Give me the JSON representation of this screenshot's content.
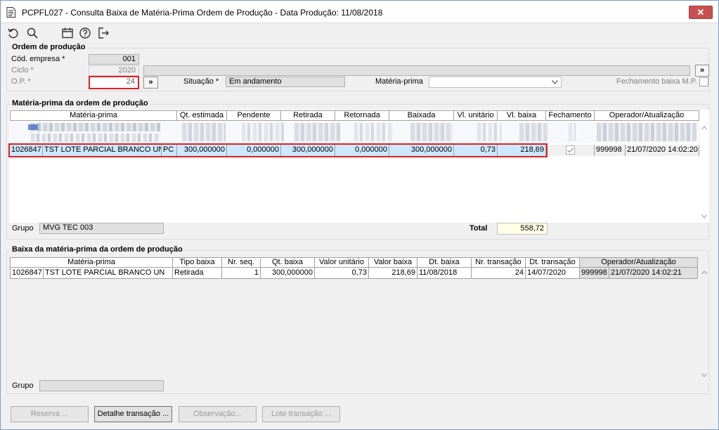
{
  "window": {
    "title": "PCPFL027 - Consulta Baixa de Matéria-Prima Ordem de Produção - Data Produção: 11/08/2018",
    "close": "✕"
  },
  "toolbar": {
    "icons": [
      "undo-icon",
      "search-icon",
      "calendar-icon",
      "help-icon",
      "exit-icon"
    ]
  },
  "ordem": {
    "title": "Ordem de produção",
    "cod_empresa_label": "Cód. empresa *",
    "cod_empresa_value": "001",
    "ciclo_label": "Ciclo *",
    "ciclo_value": "2020",
    "op_label": "O.P. *",
    "op_value": "24",
    "nav_button": "»",
    "nav_button2": "»",
    "situacao_label": "Situação *",
    "situacao_value": "Em andamento",
    "materia_prima_label": "Matéria-prima",
    "fechamento_label": "Fechamento baixa M.P."
  },
  "mp_ordem": {
    "title": "Matéria-prima da ordem de produção",
    "headers": [
      "Matéria-prima",
      "Qt. estimada",
      "Pendente",
      "Retirada",
      "Retornada",
      "Baixada",
      "Vl. unitário",
      "Vl. baixa",
      "Fechamento",
      "Operador/Atualização"
    ],
    "row": {
      "codigo": "1026847",
      "descricao": "TST LOTE PARCIAL BRANCO UN",
      "un": "PC",
      "qt_estimada": "300,000000",
      "pendente": "0,000000",
      "retirada": "300,000000",
      "retornada": "0,000000",
      "baixada": "300,000000",
      "vl_unitario": "0,73",
      "vl_baixa": "218,69",
      "operador": "999998",
      "atualizacao": "21/07/2020 14:02:20"
    },
    "grupo_label": "Grupo",
    "grupo_value": "MVG TEC 003",
    "total_label": "Total",
    "total_value": "558,72"
  },
  "baixa": {
    "title": "Baixa da matéria-prima da ordem de produção",
    "headers": [
      "Matéria-prima",
      "Tipo baixa",
      "Nr. seq.",
      "Qt. baixa",
      "Valor unitário",
      "Valor baixa",
      "Dt. baixa",
      "Nr. transação",
      "Dt. transação",
      "Operador/Atualização"
    ],
    "row": {
      "codigo": "1026847",
      "descricao": "TST LOTE PARCIAL BRANCO UN",
      "tipo": "Retirada",
      "seq": "1",
      "qt_baixa": "300,000000",
      "valor_unitario": "0,73",
      "valor_baixa": "218,69",
      "dt_baixa": "11/08/2018",
      "nr_transacao": "24",
      "dt_transacao": "14/07/2020",
      "operador": "999998",
      "atualizacao": "21/07/2020 14:02:21"
    },
    "grupo_label": "Grupo"
  },
  "buttons": {
    "reserva": "Reserva ...",
    "detalhe": "Detalhe transação ...",
    "observacao": "Observação...",
    "lote": "Lote transação ..."
  },
  "colors": {
    "highlight_row": "#cce8ff",
    "red_box": "#e02020",
    "close_bg": "#c75050"
  }
}
